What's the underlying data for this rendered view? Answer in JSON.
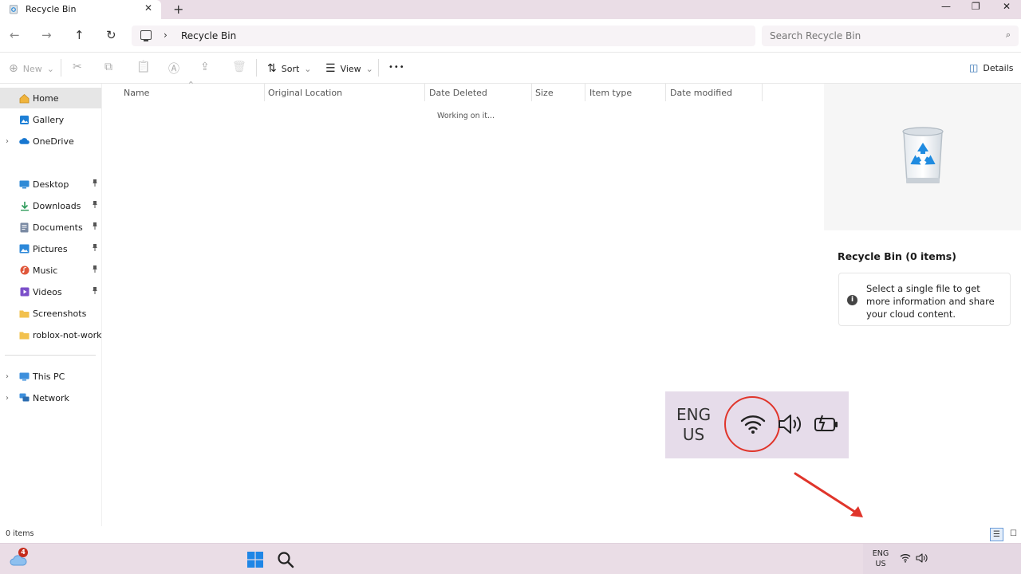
{
  "window": {
    "tab_title": "Recycle Bin",
    "tab_close": "✕",
    "new_tab": "+",
    "controls": {
      "minimize": "—",
      "maximize": "❐",
      "close": "✕"
    }
  },
  "navigation": {
    "back": "←",
    "forward": "→",
    "up": "↑",
    "refresh": "↻",
    "breadcrumb_separator": "›",
    "breadcrumb": "Recycle Bin",
    "search_placeholder": "Search Recycle Bin",
    "search_icon": "⌕"
  },
  "commandbar": {
    "new_label": "New",
    "sort_label": "Sort",
    "view_label": "View",
    "more_label": "•••",
    "details_label": "Details",
    "caret": "⌄",
    "icons": {
      "new": "⊕",
      "cut": "✂",
      "copy": "⧉",
      "paste": "📋",
      "rename": "Ⓐ",
      "share": "⇪",
      "delete": "🗑",
      "sort": "⇅",
      "view": "☰",
      "details": "◫"
    }
  },
  "sidebar": {
    "expander": "›",
    "pin": "📌",
    "items": [
      {
        "label": "Home",
        "icon": "home-icon",
        "glyph": "⌂",
        "color": "#e7a53b"
      },
      {
        "label": "Gallery",
        "icon": "gallery-icon",
        "glyph": "▣",
        "color": "#1d7fd6"
      },
      {
        "label": "OneDrive",
        "icon": "cloud-icon",
        "glyph": "☁",
        "color": "#1877d0"
      },
      {
        "label": "Desktop",
        "icon": "desktop-icon",
        "glyph": "▬",
        "color": "#2f8ad6"
      },
      {
        "label": "Downloads",
        "icon": "download-icon",
        "glyph": "⤓",
        "color": "#2e9b5a"
      },
      {
        "label": "Documents",
        "icon": "document-icon",
        "glyph": "▤",
        "color": "#5a6e8c"
      },
      {
        "label": "Pictures",
        "icon": "picture-icon",
        "glyph": "▨",
        "color": "#2c88d9"
      },
      {
        "label": "Music",
        "icon": "music-icon",
        "glyph": "♪",
        "color": "#e0573b"
      },
      {
        "label": "Videos",
        "icon": "video-icon",
        "glyph": "▶",
        "color": "#7b4fc9"
      },
      {
        "label": "Screenshots",
        "icon": "folder-icon",
        "glyph": "▆",
        "color": "#f2c14e"
      },
      {
        "label": "roblox-not-working",
        "icon": "folder-icon",
        "glyph": "▆",
        "color": "#f2c14e"
      },
      {
        "label": "This PC",
        "icon": "this-pc-icon",
        "glyph": "▭",
        "color": "#2b7bd0"
      },
      {
        "label": "Network",
        "icon": "network-icon",
        "glyph": "⊞",
        "color": "#2b7bd0"
      }
    ]
  },
  "columns": [
    "Name",
    "Original Location",
    "Date Deleted",
    "Size",
    "Item type",
    "Date modified"
  ],
  "sort_caret": "^",
  "content_status": "Working on it...",
  "details_pane": {
    "title": "Recycle Bin (0 items)",
    "info_icon": "i",
    "message": "Select a single file to get more information and share your cloud content."
  },
  "statusbar": {
    "count": "0 items",
    "details_view_glyph": "☰",
    "tiles_view_glyph": "☐"
  },
  "callout": {
    "lang_line1": "ENG",
    "lang_line2": "US",
    "highlight_color": "#e0352b"
  },
  "taskbar": {
    "weather_badge": "4",
    "tray_lang_line1": "ENG",
    "tray_lang_line2": "US"
  },
  "colors": {
    "titlebar": "#eadde6",
    "taskbar": "#eadde6",
    "accent": "#0078d4",
    "annotation_red": "#e0352b"
  }
}
